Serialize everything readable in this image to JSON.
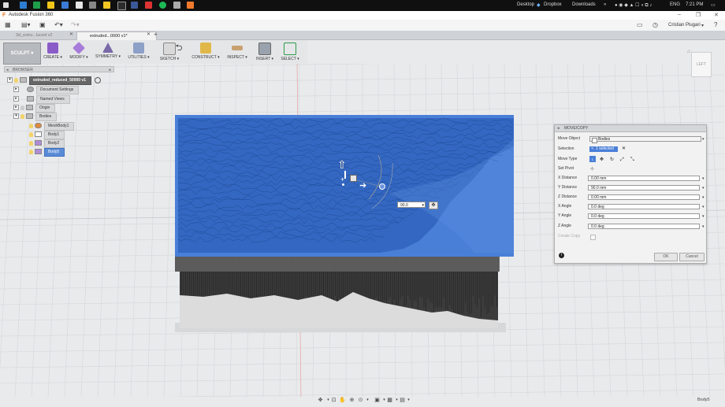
{
  "taskbar": {
    "desktop_label": "Desktop",
    "dropbox_label": "Dropbox",
    "downloads_label": "Downloads",
    "language": "ENG",
    "time": "7:21 PM"
  },
  "window": {
    "title": "Autodesk Fusion 360"
  },
  "quick_access": {
    "user_name": "Cristian Plugari"
  },
  "tabs": [
    {
      "label": "3d_extru...luced v2"
    },
    {
      "label": "extruded...0000 v1*"
    }
  ],
  "toolbar": {
    "workspace": "SCULPT",
    "tools": [
      {
        "label": "CREATE"
      },
      {
        "label": "MODIFY"
      },
      {
        "label": "SYMMETRY"
      },
      {
        "label": "UTILITIES"
      },
      {
        "label": "SKETCH"
      },
      {
        "label": "CONSTRUCT"
      },
      {
        "label": "INSPECT"
      },
      {
        "label": "INSERT"
      },
      {
        "label": "SELECT"
      }
    ]
  },
  "browser": {
    "title": "BROWSER",
    "root": "extruded_reduced_50000 v1",
    "items": [
      {
        "label": "Document Settings"
      },
      {
        "label": "Named Views"
      },
      {
        "label": "Origin"
      },
      {
        "label": "Bodies"
      }
    ],
    "bodies": [
      {
        "label": "MeshBody1"
      },
      {
        "label": "Body1"
      },
      {
        "label": "Body2"
      },
      {
        "label": "Body5"
      }
    ]
  },
  "viewcube": {
    "face": "LEFT"
  },
  "manipulator": {
    "distance_value": "90.0"
  },
  "move_dialog": {
    "title": "MOVE/COPY",
    "move_object_label": "Move Object",
    "move_object_value": "Bodies",
    "selection_label": "Selection",
    "selection_value": "1 selected",
    "move_type_label": "Move Type",
    "set_pivot_label": "Set Pivot",
    "fields": [
      {
        "label": "X Distance",
        "value": "0.00 mm"
      },
      {
        "label": "Y Distance",
        "value": "90.0 mm"
      },
      {
        "label": "Z Distance",
        "value": "0.00 mm"
      },
      {
        "label": "X Angle",
        "value": "0.0 deg"
      },
      {
        "label": "Y Angle",
        "value": "0.0 deg"
      },
      {
        "label": "Z Angle",
        "value": "0.0 deg"
      }
    ],
    "create_copy_label": "Create Copy",
    "ok_label": "OK",
    "cancel_label": "Cancel"
  },
  "status": {
    "selected_body": "Body5"
  },
  "colors": {
    "selection_blue": "#4a7fd8",
    "toolbar_bg": "#e5e6e8",
    "taskbar_bg": "#101010"
  }
}
